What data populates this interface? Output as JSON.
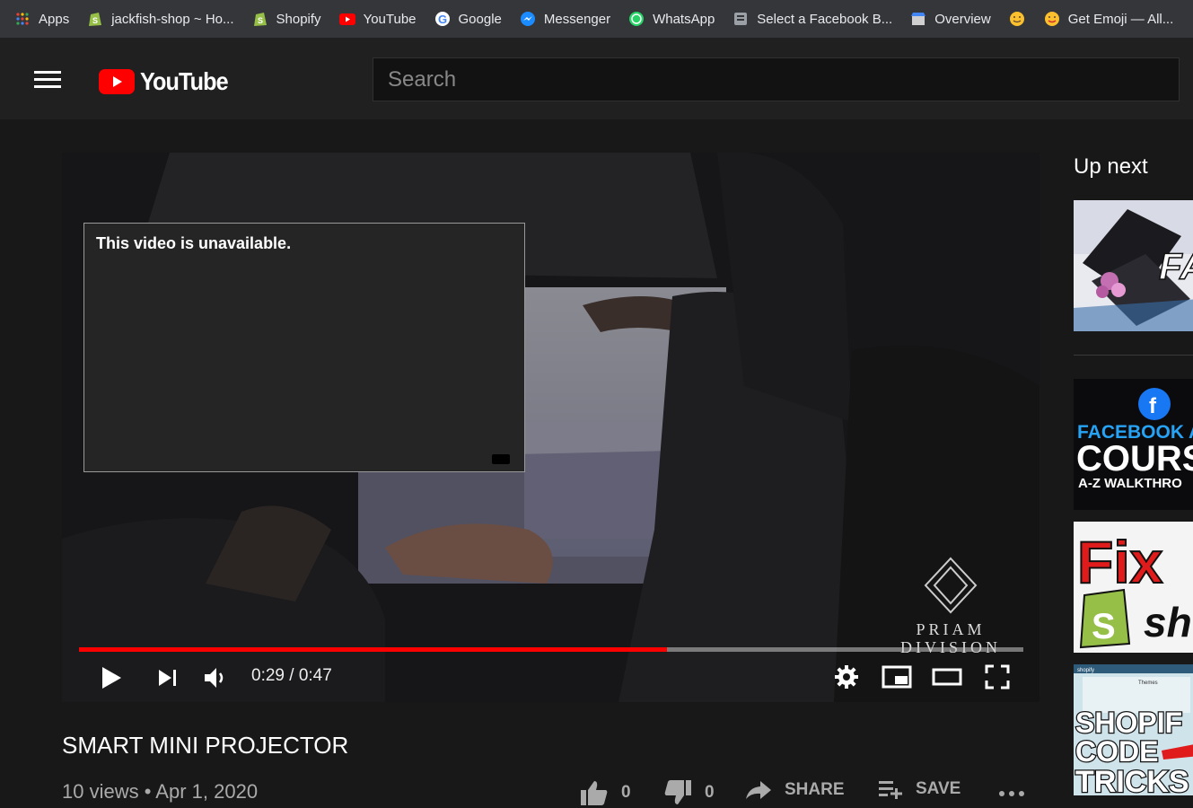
{
  "bookmarks": [
    {
      "label": "Apps",
      "icon": "apps-grid-icon"
    },
    {
      "label": "jackfish-shop ~ Ho...",
      "icon": "shopify-icon"
    },
    {
      "label": "Shopify",
      "icon": "shopify-icon"
    },
    {
      "label": "YouTube",
      "icon": "youtube-icon"
    },
    {
      "label": "Google",
      "icon": "google-icon"
    },
    {
      "label": "Messenger",
      "icon": "messenger-icon"
    },
    {
      "label": "WhatsApp",
      "icon": "whatsapp-icon"
    },
    {
      "label": "Select a Facebook B...",
      "icon": "page-icon"
    },
    {
      "label": "Overview",
      "icon": "store-icon"
    },
    {
      "label": "",
      "icon": "emoji-icon"
    },
    {
      "label": "Get Emoji — All...",
      "icon": "emoji-icon"
    }
  ],
  "masthead": {
    "logo_text": "YouTube",
    "search_placeholder": "Search"
  },
  "player": {
    "error_message": "This video is unavailable.",
    "current_time": "0:29",
    "duration": "0:47",
    "time_display": "0:29 / 0:47",
    "progress_fraction": 0.623,
    "watermark_line1": "PRIAM",
    "watermark_line2": "DIVISION"
  },
  "video": {
    "title": "SMART MINI PROJECTOR",
    "meta": "10 views • Apr 1, 2020",
    "like_count": "0",
    "dislike_count": "0",
    "share_label": "SHARE",
    "save_label": "SAVE"
  },
  "sidebar": {
    "heading": "Up next",
    "thumbnails": [
      {
        "text": "FA"
      },
      {
        "line1": "FACEBOOK A",
        "line2": "COURS",
        "line3": "A-Z WALKTHRO"
      },
      {
        "line1": "Fix",
        "line2": "sh"
      },
      {
        "line1": "SHOPIF",
        "line2": "CODE",
        "line3": "TRICKS",
        "small": "shopify",
        "small2": "Themes"
      }
    ]
  },
  "colors": {
    "accent": "#ff0000",
    "background": "#181818",
    "masthead": "#202020",
    "bookmarks_bar": "#35363a"
  }
}
